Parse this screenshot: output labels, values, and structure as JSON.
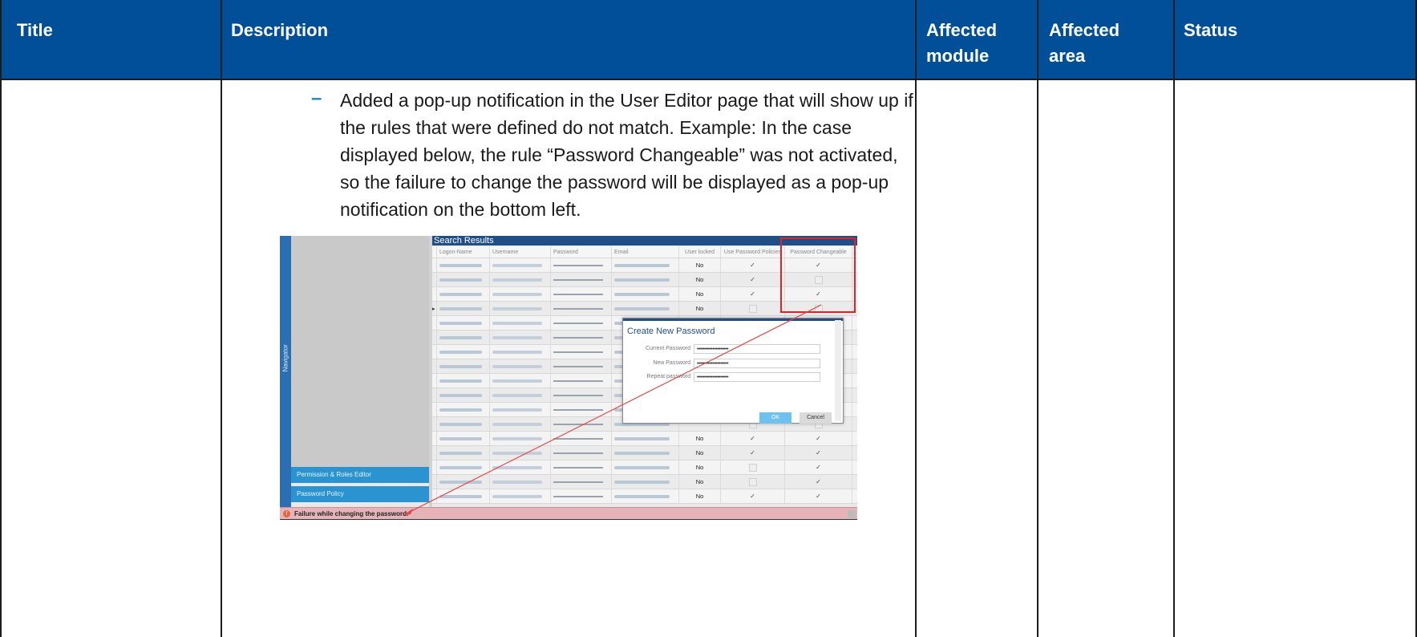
{
  "table": {
    "headers": {
      "title": "Title",
      "description": "Description",
      "affected_module": "Affected module",
      "affected_area": "Affected area",
      "status": "Status"
    },
    "row": {
      "bullet": "–",
      "description_text": "Added a pop-up notification in the User Editor page that will show up if the rules that were defined do not match. Example: In the case displayed below, the rule “Password Changeable” was not activated, so the failure to change the password will be displayed as a pop-up notification on the bottom left."
    }
  },
  "screenshot": {
    "navigator_label": "Navigator",
    "menu": [
      "Permission & Roles Editor",
      "Password Policy"
    ],
    "results_title": "Search Results",
    "columns": [
      "Logon-Name",
      "Username",
      "Password",
      "Email",
      "User locked",
      "Use Password Policies",
      "Password Changeable"
    ],
    "rows": [
      {
        "locked": "No",
        "policy": true,
        "changeable": true
      },
      {
        "locked": "No",
        "policy": true,
        "changeable": false
      },
      {
        "locked": "No",
        "policy": true,
        "changeable": true
      },
      {
        "locked": "No",
        "policy": false,
        "changeable": false
      },
      {
        "locked": "",
        "policy": false,
        "changeable": false
      },
      {
        "locked": "",
        "policy": false,
        "changeable": false
      },
      {
        "locked": "",
        "policy": false,
        "changeable": false
      },
      {
        "locked": "",
        "policy": false,
        "changeable": false
      },
      {
        "locked": "",
        "policy": false,
        "changeable": false
      },
      {
        "locked": "",
        "policy": false,
        "changeable": false
      },
      {
        "locked": "",
        "policy": false,
        "changeable": false
      },
      {
        "locked": "",
        "policy": false,
        "changeable": false
      },
      {
        "locked": "No",
        "policy": true,
        "changeable": true
      },
      {
        "locked": "No",
        "policy": true,
        "changeable": true
      },
      {
        "locked": "No",
        "policy": false,
        "changeable": true
      },
      {
        "locked": "No",
        "policy": false,
        "changeable": true
      },
      {
        "locked": "No",
        "policy": true,
        "changeable": true
      }
    ],
    "dialog": {
      "title": "Create New Password",
      "fields": [
        {
          "label": "Current Password",
          "value": "••••••••••••••••••••"
        },
        {
          "label": "New Password",
          "value": "••••••••••••••••••••"
        },
        {
          "label": "Repeat password",
          "value": "••••••••••••••••••••"
        }
      ],
      "ok_label": "OK",
      "cancel_label": "Cancel"
    },
    "status_message": "Failure while changing the password.",
    "status_icon": "!",
    "colors": {
      "header_blue": "#004f98",
      "navigator_blue": "#2a6fb3",
      "menu_blue": "#2b93cf",
      "highlight_red": "#e02424",
      "status_pink": "#e6b3b8"
    }
  }
}
